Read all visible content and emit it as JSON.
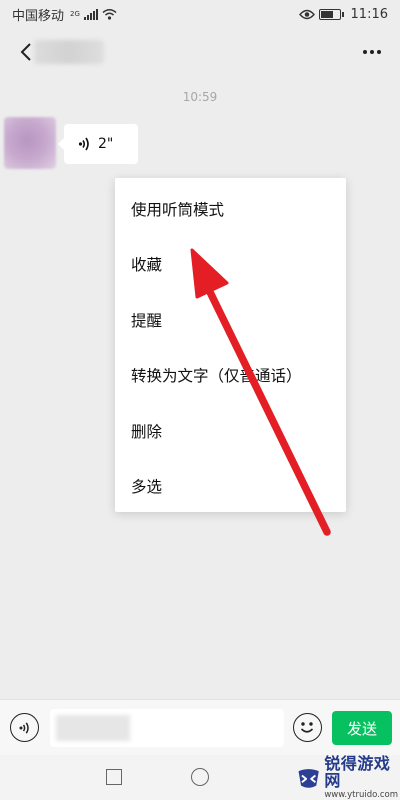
{
  "status_bar": {
    "carrier": "中国移动",
    "network_badge": "2G",
    "time": "11:16"
  },
  "chat": {
    "timestamp": "10:59",
    "voice_message": {
      "duration": "2\""
    }
  },
  "context_menu": {
    "items": [
      {
        "label": "使用听筒模式"
      },
      {
        "label": "收藏"
      },
      {
        "label": "提醒"
      },
      {
        "label": "转换为文字（仅普通话）"
      },
      {
        "label": "删除"
      },
      {
        "label": "多选"
      }
    ]
  },
  "input_bar": {
    "send_label": "发送"
  },
  "watermark": {
    "title": "锐得游戏网",
    "url": "www.ytruido.com"
  },
  "colors": {
    "accent": "#07c160",
    "annotation_arrow": "#e31e24",
    "background": "#ededed"
  },
  "icons": [
    "signal-icon",
    "wifi-icon",
    "eye-icon",
    "battery-icon",
    "back-icon",
    "more-icon",
    "voice-wave-icon",
    "emoji-icon",
    "nav-square-icon",
    "nav-circle-icon",
    "watermark-logo-icon"
  ]
}
